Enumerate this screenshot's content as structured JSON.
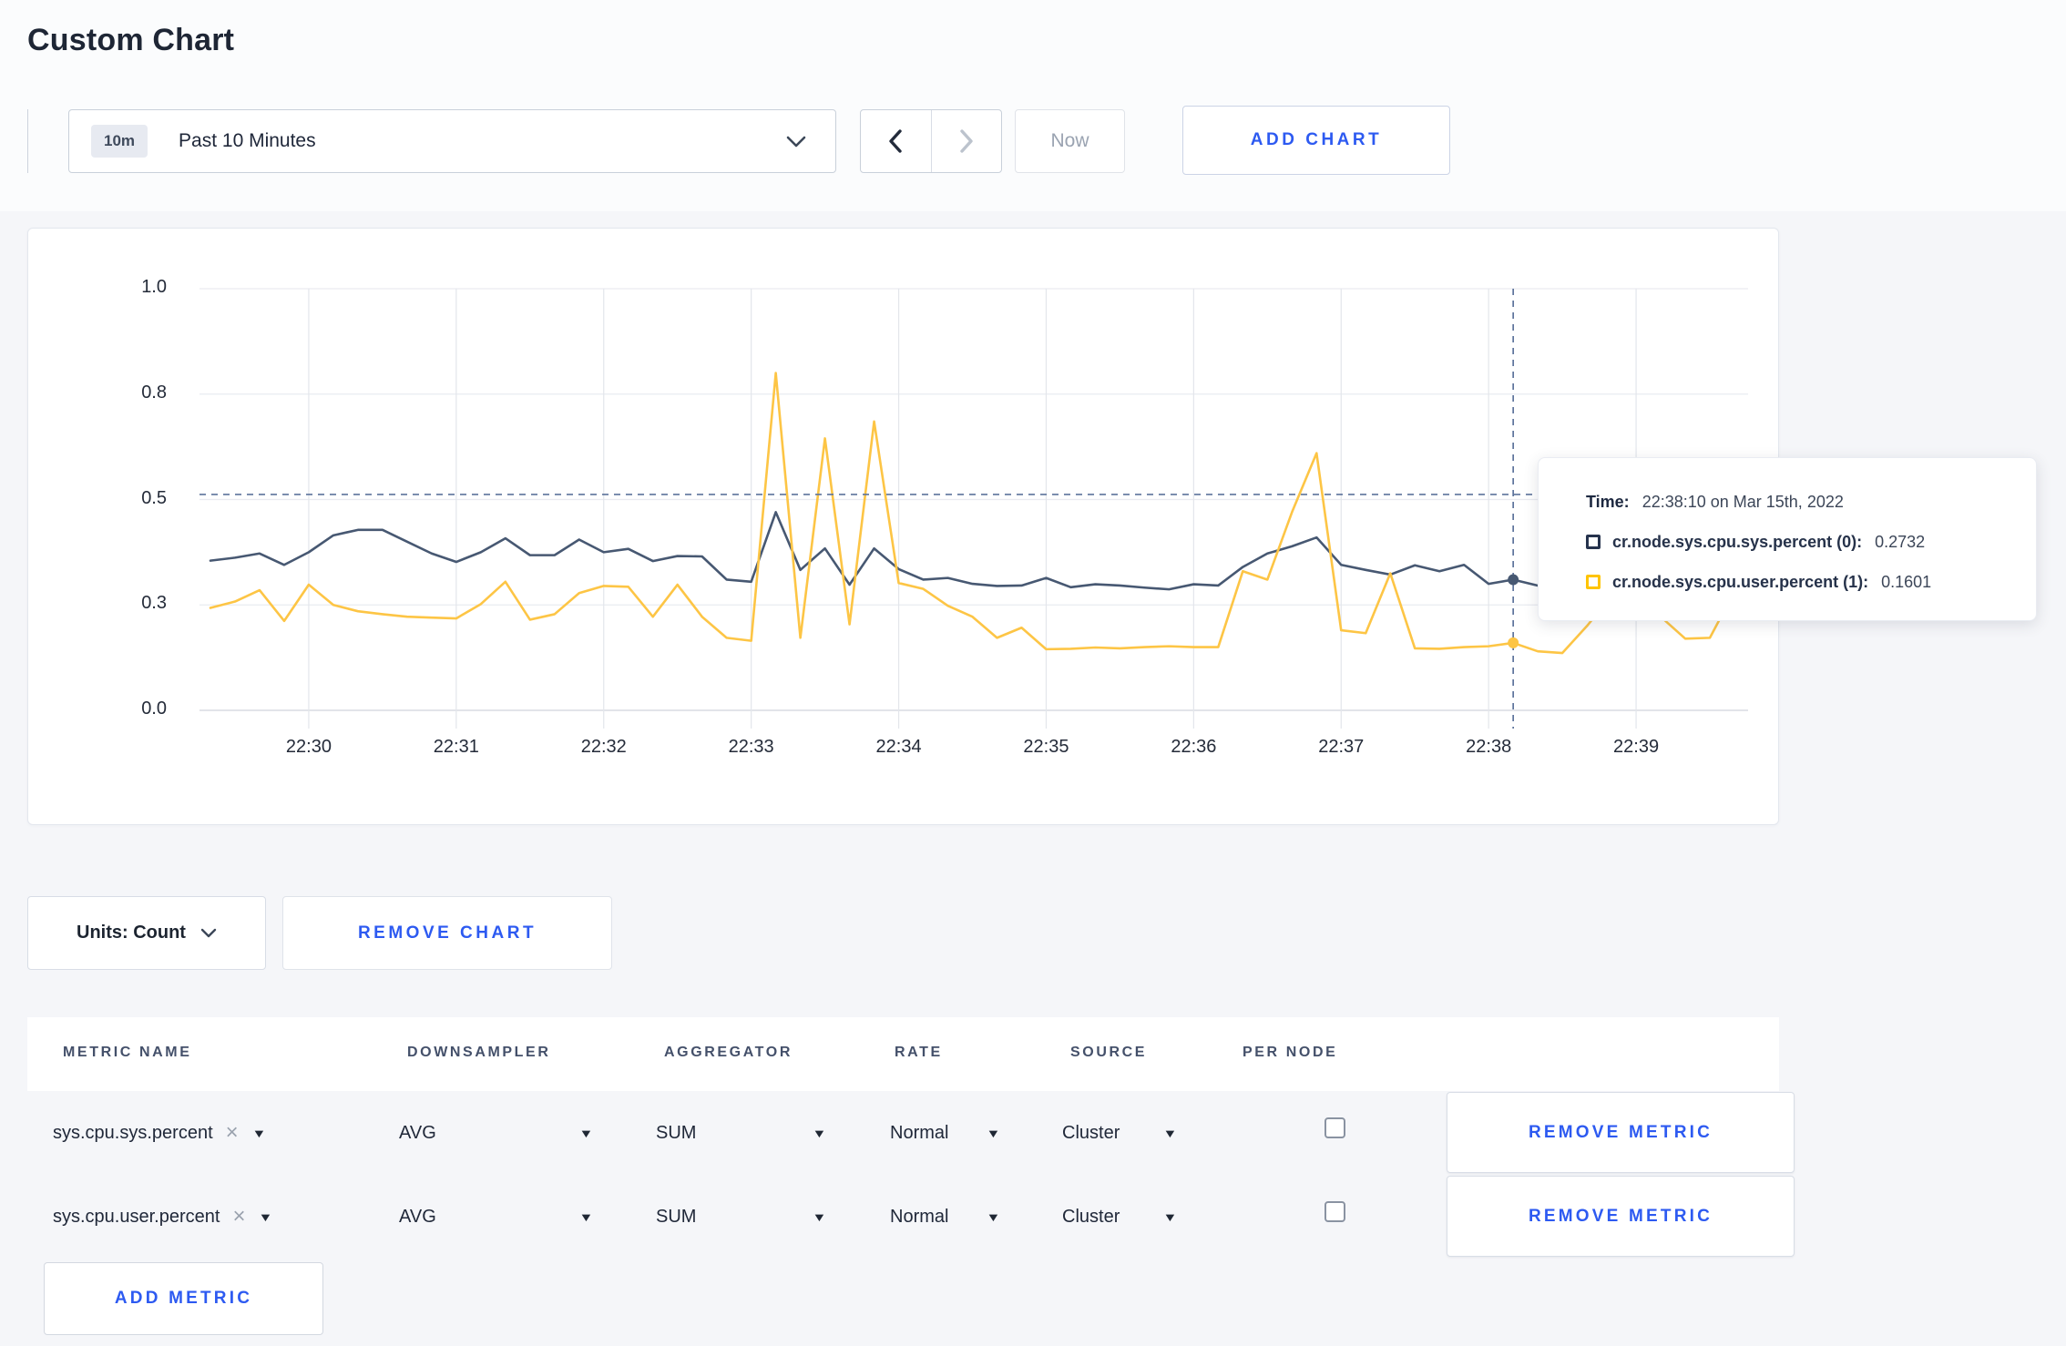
{
  "page": {
    "title": "Custom Chart"
  },
  "toolbar": {
    "time_range": {
      "badge": "10m",
      "label": "Past 10 Minutes"
    },
    "now_label": "Now",
    "add_chart_label": "ADD CHART"
  },
  "chart_data": {
    "type": "line",
    "ylabel": "",
    "xlabel": "",
    "grid": true,
    "legend_position": "tooltip",
    "y_axis": {
      "range": [
        0,
        1
      ],
      "ticks": [
        {
          "value": 0.0,
          "label": "0.0"
        },
        {
          "value": 0.25,
          "label": "0.3"
        },
        {
          "value": 0.5,
          "label": "0.5"
        },
        {
          "value": 0.75,
          "label": "0.8"
        },
        {
          "value": 1.0,
          "label": "1.0"
        }
      ]
    },
    "x_axis": {
      "start_time": "22:29:20",
      "point_interval_seconds": 10,
      "ticks": [
        {
          "t": 40,
          "label": "22:30"
        },
        {
          "t": 100,
          "label": "22:31"
        },
        {
          "t": 160,
          "label": "22:32"
        },
        {
          "t": 220,
          "label": "22:33"
        },
        {
          "t": 280,
          "label": "22:34"
        },
        {
          "t": 340,
          "label": "22:35"
        },
        {
          "t": 400,
          "label": "22:36"
        },
        {
          "t": 460,
          "label": "22:37"
        },
        {
          "t": 520,
          "label": "22:38"
        },
        {
          "t": 580,
          "label": "22:39"
        }
      ]
    },
    "series": [
      {
        "name": "cr.node.sys.cpu.sys.percent",
        "color": "#475872",
        "values": [
          0.355,
          0.362,
          0.372,
          0.345,
          0.375,
          0.415,
          0.428,
          0.428,
          0.4,
          0.372,
          0.352,
          0.375,
          0.408,
          0.368,
          0.368,
          0.405,
          0.375,
          0.383,
          0.354,
          0.366,
          0.365,
          0.31,
          0.305,
          0.47,
          0.333,
          0.384,
          0.298,
          0.384,
          0.335,
          0.31,
          0.314,
          0.3,
          0.295,
          0.296,
          0.314,
          0.292,
          0.299,
          0.296,
          0.291,
          0.287,
          0.299,
          0.296,
          0.34,
          0.372,
          0.389,
          0.41,
          0.345,
          0.333,
          0.322,
          0.344,
          0.33,
          0.345,
          0.3,
          0.31,
          0.296,
          0.3,
          0.316,
          0.3,
          0.295,
          0.3,
          0.31,
          0.316,
          0.3,
          0.305
        ]
      },
      {
        "name": "cr.node.sys.cpu.user.percent",
        "color": "#fdc545",
        "values": [
          0.243,
          0.258,
          0.285,
          0.212,
          0.298,
          0.25,
          0.235,
          0.228,
          0.222,
          0.22,
          0.218,
          0.252,
          0.305,
          0.215,
          0.228,
          0.278,
          0.295,
          0.293,
          0.222,
          0.298,
          0.222,
          0.172,
          0.165,
          0.8,
          0.172,
          0.645,
          0.204,
          0.685,
          0.302,
          0.288,
          0.248,
          0.222,
          0.172,
          0.196,
          0.145,
          0.146,
          0.149,
          0.147,
          0.15,
          0.152,
          0.15,
          0.15,
          0.33,
          0.31,
          0.47,
          0.61,
          0.19,
          0.183,
          0.325,
          0.147,
          0.146,
          0.15,
          0.152,
          0.16,
          0.14,
          0.136,
          0.2,
          0.272,
          0.24,
          0.222,
          0.17,
          0.172,
          0.282,
          0.244
        ]
      }
    ],
    "crosshair": {
      "t": 530,
      "h_value": 0.512,
      "points": [
        {
          "value": 0.31,
          "color": "#475872"
        },
        {
          "value": 0.16,
          "color": "#fdc545"
        }
      ]
    }
  },
  "tooltip": {
    "time_label": "Time:",
    "time_value": "22:38:10 on Mar 15th, 2022",
    "series": [
      {
        "name": "cr.node.sys.cpu.sys.percent (0):",
        "value": "0.2732",
        "swatch": "#26334d"
      },
      {
        "name": "cr.node.sys.cpu.user.percent (1):",
        "value": "0.1601",
        "swatch": "#ffc400"
      }
    ]
  },
  "chart_actions": {
    "units_label": "Units: Count",
    "remove_chart_label": "REMOVE CHART"
  },
  "metrics_table": {
    "columns": [
      "METRIC NAME",
      "DOWNSAMPLER",
      "AGGREGATOR",
      "RATE",
      "SOURCE",
      "PER NODE"
    ],
    "rows": [
      {
        "name": "sys.cpu.sys.percent",
        "downsampler": "AVG",
        "aggregator": "SUM",
        "rate": "Normal",
        "source": "Cluster",
        "per_node_checked": false,
        "remove_label": "REMOVE METRIC"
      },
      {
        "name": "sys.cpu.user.percent",
        "downsampler": "AVG",
        "aggregator": "SUM",
        "rate": "Normal",
        "source": "Cluster",
        "per_node_checked": false,
        "remove_label": "REMOVE METRIC"
      }
    ],
    "add_metric_label": "ADD METRIC"
  },
  "icons": {
    "dropdown_caret": "▼",
    "remove_x": "×"
  }
}
